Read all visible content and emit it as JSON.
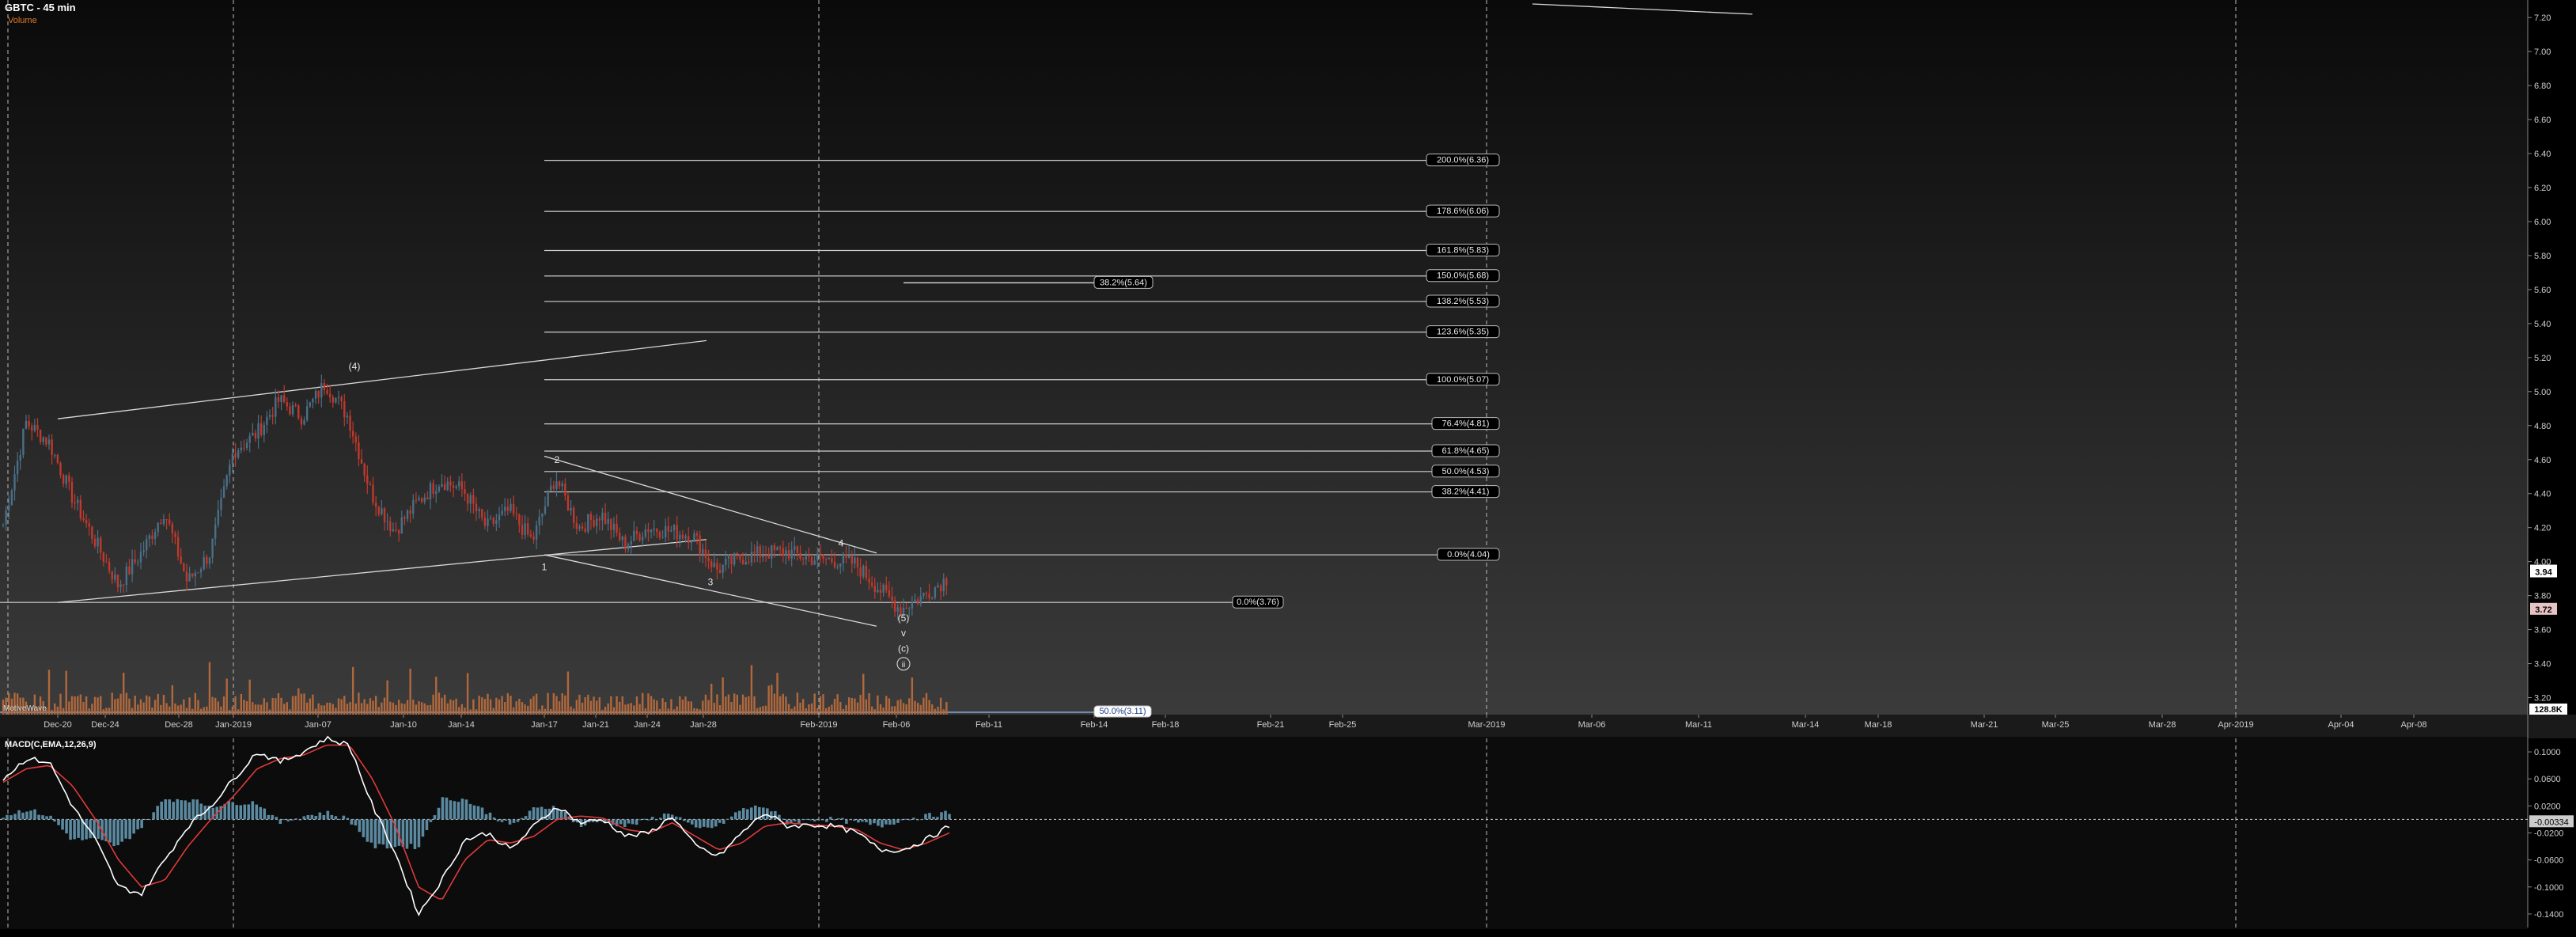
{
  "title": "GBTC - 45 min",
  "volume_label": "Volume",
  "motivewave_label": "MotiveWave",
  "macd_label": "MACD(C,EMA,12,26,9)",
  "colors": {
    "up": "#4a6f86",
    "down": "#c0392b",
    "volume": "#b0683c",
    "fib_line": "#cfcfcf",
    "trendline": "#d9d9d9",
    "macd_line": "#ffffff",
    "signal_line": "#e03a3a",
    "histogram": "#5b8aa0",
    "price_tag_current": "#ffffff",
    "price_tag_low": "#e8c3c3"
  },
  "chart_data": [
    {
      "type": "candlestick",
      "name": "price",
      "ylim": [
        3.1,
        7.28
      ],
      "y_ticks": [
        "7.20",
        "7.00",
        "6.80",
        "6.60",
        "6.40",
        "6.20",
        "6.00",
        "5.80",
        "5.60",
        "5.40",
        "5.20",
        "5.00",
        "4.80",
        "4.60",
        "4.40",
        "4.20",
        "4.00",
        "3.80",
        "3.60",
        "3.40",
        "3.20"
      ],
      "x_ticks": [
        "Dec-20",
        "Dec-24",
        "Dec-28",
        "Jan-2019",
        "Jan-07",
        "Jan-10",
        "Jan-14",
        "Jan-17",
        "Jan-21",
        "Jan-24",
        "Jan-28",
        "Feb-2019",
        "Feb-06",
        "Feb-11",
        "Feb-14",
        "Feb-18",
        "Feb-21",
        "Feb-25",
        "Mar-2019",
        "Mar-06",
        "Mar-11",
        "Mar-14",
        "Mar-18",
        "Mar-21",
        "Mar-25",
        "Mar-28",
        "Apr-2019",
        "Apr-04",
        "Apr-08"
      ],
      "anchors": [
        4.22,
        4.82,
        4.7,
        4.38,
        4.12,
        3.86,
        4.05,
        4.3,
        3.88,
        4.05,
        4.65,
        4.75,
        4.95,
        4.85,
        5.05,
        4.85,
        4.4,
        4.18,
        4.35,
        4.48,
        4.42,
        4.2,
        4.3,
        4.12,
        4.5,
        4.2,
        4.28,
        4.1,
        4.2,
        4.18,
        4.15,
        3.95,
        4.02,
        4.05,
        4.06,
        4.02,
        4.01,
        3.99,
        3.85,
        3.72,
        3.8,
        3.9
      ],
      "last_price": "3.94",
      "low_price": "3.72",
      "volume_tag": "128.8K",
      "fib_levels": [
        {
          "label": "200.0%(6.36)",
          "value": 6.36
        },
        {
          "label": "178.6%(6.06)",
          "value": 6.06
        },
        {
          "label": "161.8%(5.83)",
          "value": 5.83
        },
        {
          "label": "150.0%(5.68)",
          "value": 5.68
        },
        {
          "label": "138.2%(5.53)",
          "value": 5.53
        },
        {
          "label": "123.6%(5.35)",
          "value": 5.35
        },
        {
          "label": "100.0%(5.07)",
          "value": 5.07
        },
        {
          "label": "76.4%(4.81)",
          "value": 4.81
        },
        {
          "label": "61.8%(4.65)",
          "value": 4.65
        },
        {
          "label": "50.0%(4.53)",
          "value": 4.53
        },
        {
          "label": "38.2%(4.41)",
          "value": 4.41
        },
        {
          "label": "0.0%(4.04)",
          "value": 4.04
        }
      ],
      "extra_levels": [
        {
          "label": "38.2%(5.64)",
          "value": 5.64
        },
        {
          "label": "0.0%(3.76)",
          "value": 3.76
        },
        {
          "label": "50.0%(3.11)",
          "value": 3.11
        }
      ],
      "wave_labels": [
        "(4)",
        "2",
        "1",
        "3",
        "4",
        "(5)",
        "v",
        "(c)",
        "ii"
      ]
    },
    {
      "type": "line",
      "name": "MACD",
      "ylim": [
        -0.16,
        0.12
      ],
      "y_ticks": [
        "0.1000",
        "0.0600",
        "0.0200",
        "-0.0200",
        "-0.0600",
        "-0.1000",
        "-0.1400"
      ],
      "current_value": "-0.00334",
      "series": [
        {
          "name": "MACD",
          "values": [
            0.06,
            0.09,
            0.085,
            0.02,
            -0.03,
            -0.1,
            -0.11,
            -0.06,
            -0.01,
            0.02,
            0.06,
            0.1,
            0.085,
            0.1,
            0.12,
            0.11,
            0.02,
            -0.05,
            -0.14,
            -0.09,
            -0.03,
            -0.02,
            -0.045,
            -0.01,
            0.02,
            -0.005,
            0.0,
            -0.025,
            -0.02,
            0.005,
            -0.04,
            -0.055,
            -0.02,
            0.01,
            -0.01,
            -0.008,
            -0.01,
            -0.02,
            -0.045,
            -0.045,
            -0.03,
            -0.01
          ]
        },
        {
          "name": "Signal",
          "values": [
            0.055,
            0.075,
            0.08,
            0.05,
            0.0,
            -0.06,
            -0.1,
            -0.09,
            -0.04,
            0.0,
            0.035,
            0.075,
            0.09,
            0.095,
            0.11,
            0.11,
            0.06,
            -0.01,
            -0.1,
            -0.12,
            -0.06,
            -0.03,
            -0.035,
            -0.025,
            0.0,
            0.005,
            0.002,
            -0.015,
            -0.02,
            -0.005,
            -0.025,
            -0.045,
            -0.035,
            -0.01,
            -0.005,
            -0.008,
            -0.01,
            -0.015,
            -0.035,
            -0.045,
            -0.035,
            -0.02
          ]
        }
      ]
    }
  ]
}
